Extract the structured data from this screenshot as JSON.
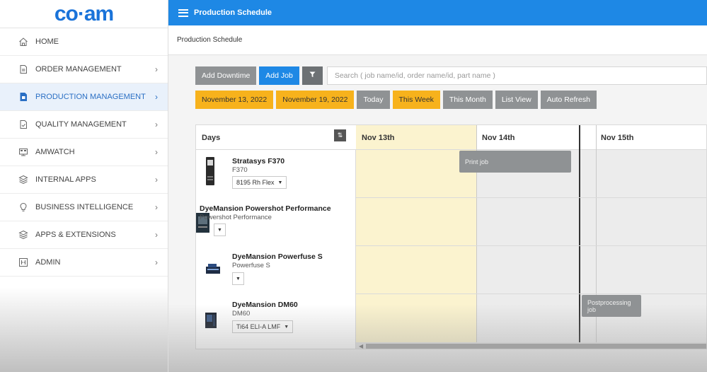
{
  "logo": {
    "text": "co·am"
  },
  "sidebar": {
    "items": [
      {
        "label": "HOME"
      },
      {
        "label": "ORDER MANAGEMENT"
      },
      {
        "label": "PRODUCTION MANAGEMENT"
      },
      {
        "label": "QUALITY MANAGEMENT"
      },
      {
        "label": "AMWATCH"
      },
      {
        "label": "INTERNAL APPS"
      },
      {
        "label": "BUSINESS INTELLIGENCE"
      },
      {
        "label": "APPS & EXTENSIONS"
      },
      {
        "label": "ADMIN"
      }
    ]
  },
  "header": {
    "title": "Production Schedule"
  },
  "breadcrumb": {
    "text": "Production Schedule"
  },
  "toolbar": {
    "add_downtime": "Add Downtime",
    "add_job": "Add Job",
    "search_placeholder": "Search ( job name/id, order name/id, part name )",
    "start_date": "November 13, 2022",
    "end_date": "November 19, 2022",
    "today": "Today",
    "this_week": "This Week",
    "this_month": "This Month",
    "list_view": "List View",
    "auto_refresh": "Auto Refresh"
  },
  "calendar": {
    "days_label": "Days",
    "day_headers": [
      "Nov 13th",
      "Nov 14th",
      "Nov 15th"
    ],
    "resources": [
      {
        "name": "Stratasys F370",
        "model": "F370",
        "material": "8195 Rh Flex"
      },
      {
        "name": "DyeMansion Powershot Performance",
        "model": "Powershot Performance",
        "material": ""
      },
      {
        "name": "DyeMansion Powerfuse S",
        "model": "Powerfuse S",
        "material": ""
      },
      {
        "name": "DyeMansion DM60",
        "model": "DM60",
        "material": "Ti64 ELI-A LMF"
      }
    ],
    "events": [
      {
        "label": "Print job"
      },
      {
        "label": "Postprocessing job"
      }
    ]
  },
  "colors": {
    "primary": "#1e88e5",
    "accent": "#f7b21c",
    "grey_button": "#8f9294",
    "highlight_column": "#fbf3cf"
  }
}
